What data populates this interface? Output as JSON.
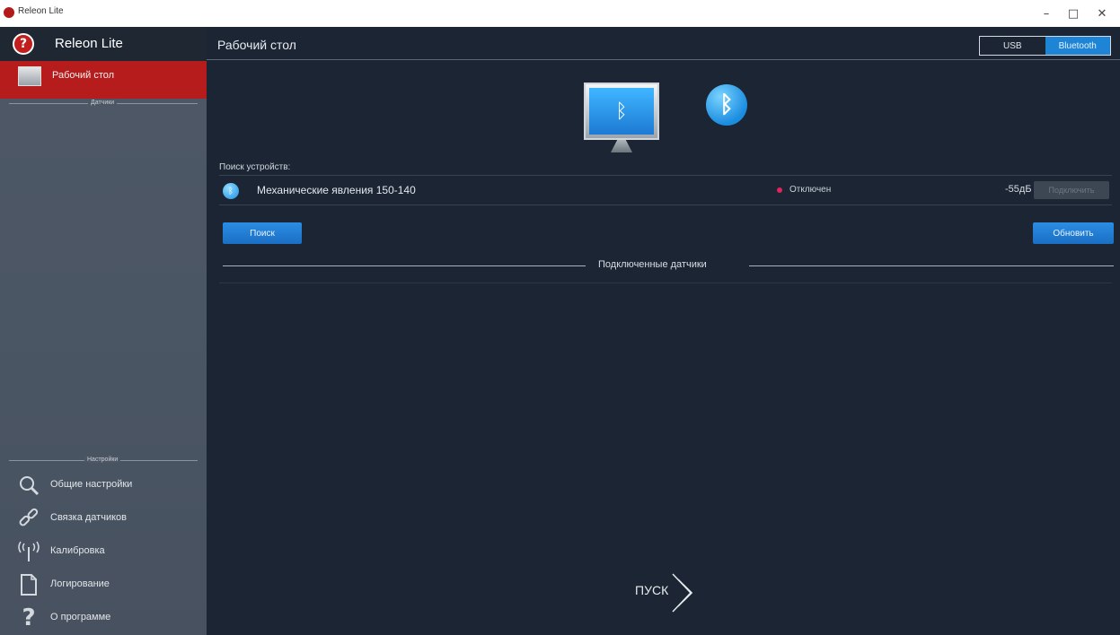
{
  "window": {
    "title": "Releon Lite",
    "minimize_glyph": "–",
    "maximize_glyph": "□",
    "close_glyph": "✕"
  },
  "sidebar": {
    "brand_name": "Releon Lite",
    "active_item": {
      "label": "Рабочий стол",
      "icon": "desktop-thumb-icon"
    },
    "sensors_divider": "Датчики",
    "settings_divider": "Настройки",
    "items": [
      {
        "label": "Общие настройки",
        "icon": "search-settings-icon"
      },
      {
        "label": "Связка датчиков",
        "icon": "link-icon"
      },
      {
        "label": "Калибровка",
        "icon": "antenna-icon"
      },
      {
        "label": "Логирование",
        "icon": "document-icon"
      },
      {
        "label": "О программе",
        "icon": "question-icon"
      }
    ]
  },
  "header": {
    "title": "Рабочий стол",
    "mode_usb": "USB",
    "mode_bluetooth": "Bluetooth",
    "selected_mode": "Bluetooth"
  },
  "main": {
    "search_caption": "Поиск устройств:",
    "devices": [
      {
        "name": "Механические явления 150-140",
        "status": "Отключен",
        "status_color": "#e0245e",
        "rssi": "-55дБ",
        "action": "Подключить"
      }
    ],
    "search_button": "Поиск",
    "refresh_button": "Обновить",
    "connected_section": "Подключенные датчики",
    "start_label": "ПУСК"
  },
  "colors": {
    "accent_blue": "#1d84d6",
    "active_red": "#b71c1c",
    "background": "#1c2533",
    "sidebar": "#4a5563"
  }
}
